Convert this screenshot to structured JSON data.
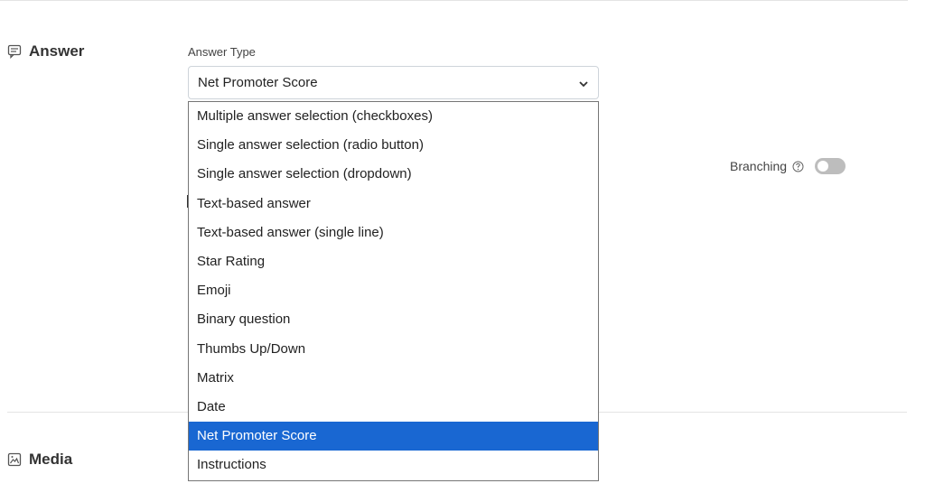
{
  "answer_section": {
    "title": "Answer",
    "icon": "comment-icon"
  },
  "media_section": {
    "title": "Media",
    "icon": "image-icon"
  },
  "answer_type": {
    "label": "Answer Type",
    "selected": "Net Promoter Score",
    "options": [
      "Multiple answer selection (checkboxes)",
      "Single answer selection (radio button)",
      "Single answer selection (dropdown)",
      "Text-based answer",
      "Text-based answer (single line)",
      "Star Rating",
      "Emoji",
      "Binary question",
      "Thumbs Up/Down",
      "Matrix",
      "Date",
      "Net Promoter Score",
      "Instructions"
    ],
    "highlighted_index": 11
  },
  "branching": {
    "label": "Branching",
    "enabled": false
  },
  "colors": {
    "highlight": "#1967d2",
    "toggle_off": "#bdbdbd"
  }
}
